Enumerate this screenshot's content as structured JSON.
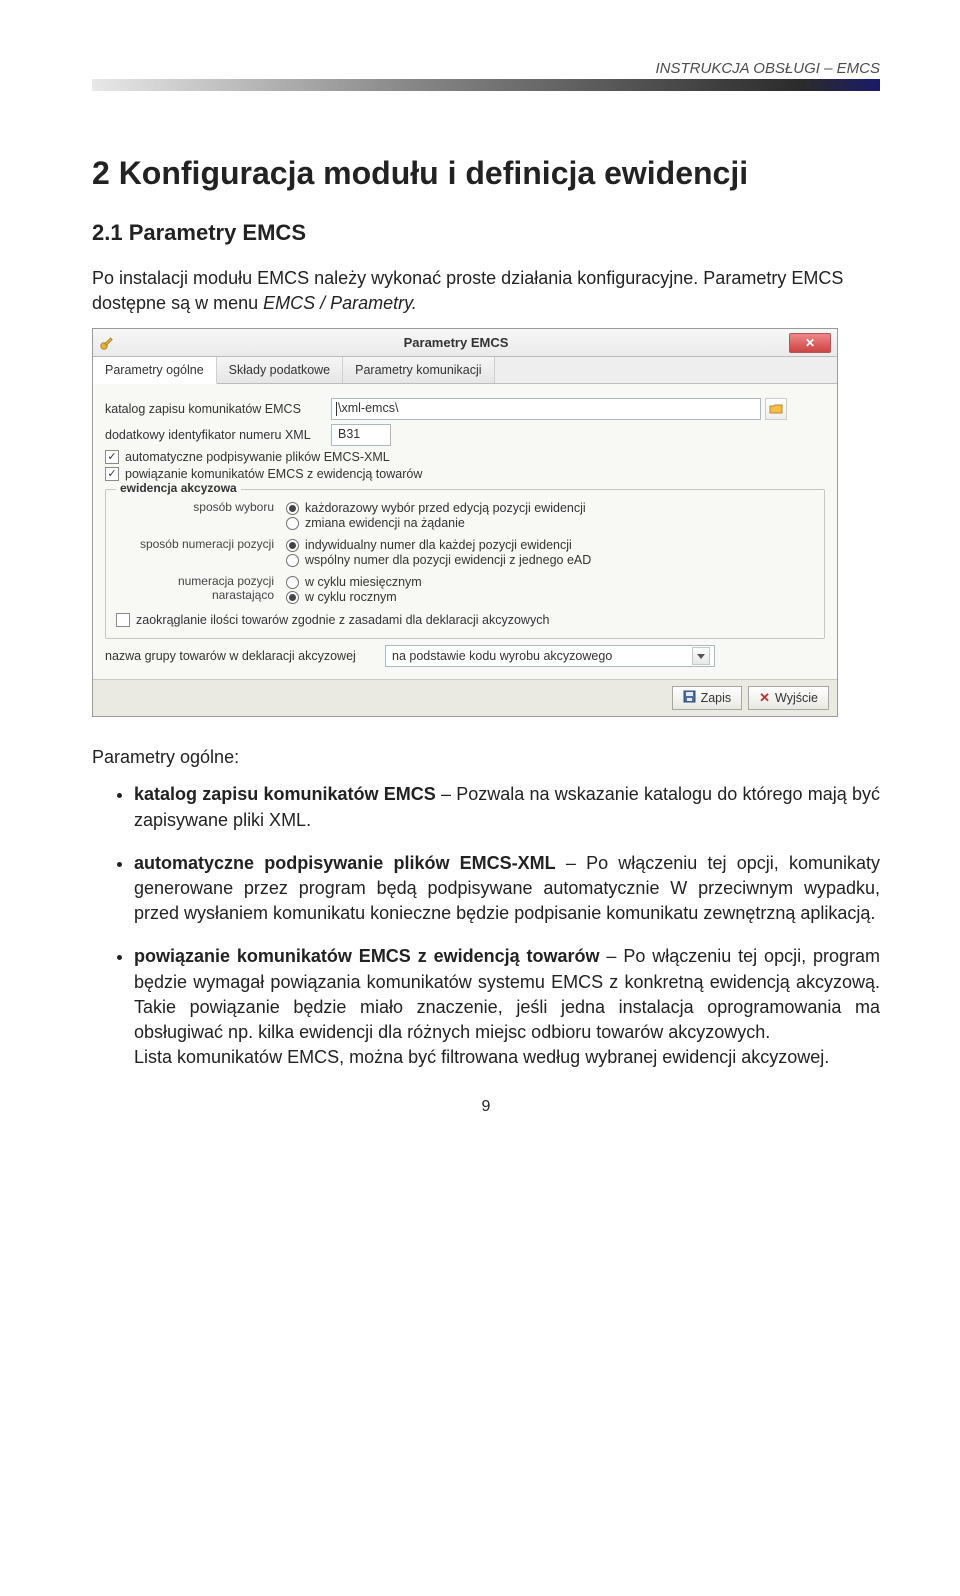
{
  "header": {
    "text": "INSTRUKCJA OBSŁUGI – EMCS"
  },
  "section": {
    "title": "2 Konfiguracja modułu i definicja ewidencji",
    "sub": "2.1 Parametry EMCS",
    "intro_a": "Po instalacji modułu EMCS należy wykonać proste działania konfiguracyjne. Parametry EMCS dostępne są w menu ",
    "intro_italic": "EMCS / Parametry."
  },
  "dialog": {
    "title": "Parametry EMCS",
    "tabs": [
      "Parametry ogólne",
      "Składy podatkowe",
      "Parametry komunikacji"
    ],
    "field1_label": "katalog zapisu komunikatów EMCS",
    "field1_value": "\\xml-emcs\\",
    "field2_label": "dodatkowy identyfikator numeru XML",
    "field2_value": "B31",
    "chk1": "automatyczne podpisywanie plików EMCS-XML",
    "chk2": "powiązanie komunikatów EMCS z ewidencją towarów",
    "fieldset_legend": "ewidencja akcyzowa",
    "r1_label": "sposób wyboru",
    "r1_opt1": "każdorazowy wybór przed edycją pozycji ewidencji",
    "r1_opt2": "zmiana ewidencji na żądanie",
    "r2_label": "sposób numeracji pozycji",
    "r2_opt1": "indywidualny numer dla każdej pozycji ewidencji",
    "r2_opt2": "wspólny numer dla pozycji ewidencji z jednego eAD",
    "r3_label": "numeracja pozycji narastająco",
    "r3_opt1": "w cyklu miesięcznym",
    "r3_opt2": "w cyklu rocznym",
    "chk3": "zaokrąglanie ilości towarów zgodnie z zasadami dla deklaracji akcyzowych",
    "combo_label": "nazwa grupy towarów w deklaracji akcyzowej",
    "combo_value": "na podstawie kodu wyrobu akcyzowego",
    "btn_save": "Zapis",
    "btn_exit": "Wyjście"
  },
  "after_heading": "Parametry ogólne:",
  "bullets": {
    "b1_term": "katalog zapisu komunikatów EMCS",
    "b1_rest": " – Pozwala na wskazanie katalogu do którego mają być zapisywane pliki XML.",
    "b2_term": "automatyczne podpisywanie plików EMCS-XML",
    "b2_rest": " – Po włączeniu tej opcji, komunikaty generowane przez program będą podpisywane automatycznie W przeciwnym wypadku, przed wysłaniem komunikatu konieczne będzie podpisanie komunikatu zewnętrzną aplikacją.",
    "b3_term": "powiązanie komunikatów EMCS z ewidencją towarów",
    "b3_rest": " – Po włączeniu tej opcji, program będzie wymagał powiązania komunikatów systemu EMCS z konkretną ewidencją akcyzową. Takie powiązanie będzie miało znaczenie, jeśli jedna instalacja oprogramowania ma obsługiwać np. kilka ewidencji dla różnych miejsc odbioru towarów akcyzowych.",
    "b3_tail": "Lista komunikatów EMCS, można być filtrowana według wybranej ewidencji akcyzowej."
  },
  "page_number": "9"
}
